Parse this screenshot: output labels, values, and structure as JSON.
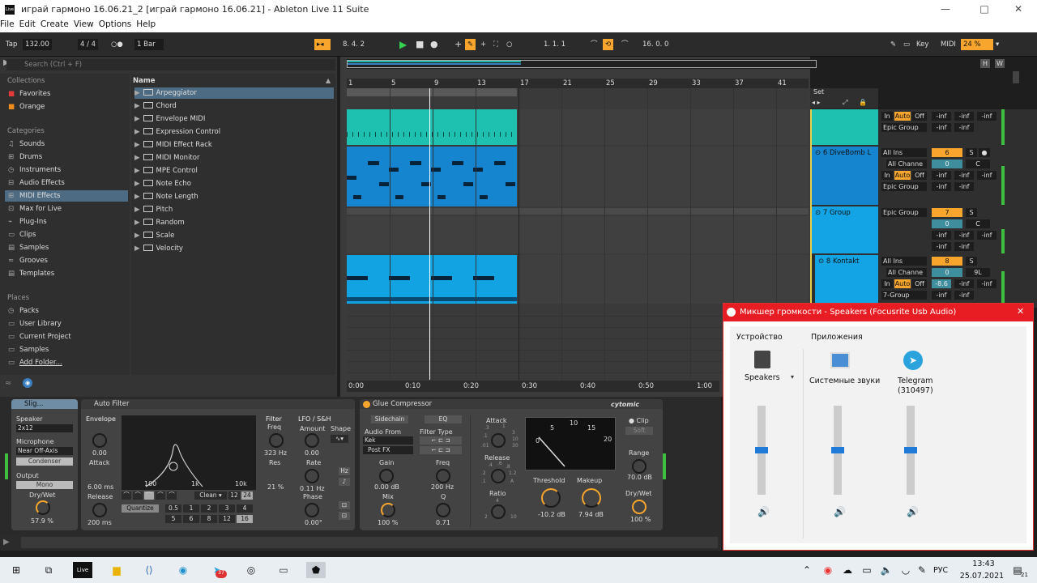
{
  "titlebar": {
    "logo": "Live",
    "title": "играй гармоно 16.06.21_2  [играй гармоно 16.06.21] - Ableton Live 11 Suite",
    "minimize": "—",
    "maximize": "□",
    "close": "✕"
  },
  "menu": [
    "File",
    "Edit",
    "Create",
    "View",
    "Options",
    "Help"
  ],
  "control": {
    "tap": "Tap",
    "tempo": "132.00",
    "signature": "4 / 4",
    "quantize": "1 Bar",
    "position": "8.  4.  2",
    "loop_start": "1.  1.  1",
    "loop_length": "16.  0.  0",
    "key": "Key",
    "midi": "MIDI",
    "cpu": "24 %"
  },
  "browser": {
    "search_placeholder": "Search (Ctrl + F)",
    "collections_header": "Collections",
    "collections": [
      {
        "label": "Favorites",
        "color": "#e33a3a"
      },
      {
        "label": "Orange",
        "color": "#f08c1e"
      }
    ],
    "categories_header": "Categories",
    "categories": [
      "Sounds",
      "Drums",
      "Instruments",
      "Audio Effects",
      "MIDI Effects",
      "Max for Live",
      "Plug-Ins",
      "Clips",
      "Samples",
      "Grooves",
      "Templates"
    ],
    "places_header": "Places",
    "places": [
      "Packs",
      "User Library",
      "Current Project",
      "Samples",
      "Add Folder..."
    ],
    "name_header": "Name",
    "items": [
      "Arpeggiator",
      "Chord",
      "Envelope MIDI",
      "Expression Control",
      "MIDI Effect Rack",
      "MIDI Monitor",
      "MPE Control",
      "Note Echo",
      "Note Length",
      "Pitch",
      "Random",
      "Scale",
      "Velocity"
    ]
  },
  "arrangement": {
    "bars": [
      "1",
      "5",
      "9",
      "13",
      "17",
      "21",
      "25",
      "29",
      "33",
      "37",
      "41"
    ],
    "times": [
      "0:00",
      "0:10",
      "0:20",
      "0:30",
      "0:40",
      "0:50",
      "1:00"
    ],
    "set_label": "Set",
    "hw_h": "H",
    "hw_w": "W"
  },
  "mixer": {
    "rows": [
      {
        "name": "",
        "in": "In",
        "auto": "Auto",
        "off": "Off",
        "group": "Epic Group",
        "vals": [
          "-inf",
          "-inf",
          "-inf",
          "-inf"
        ]
      },
      {
        "name": "6 DiveBomb L",
        "input": "All Ins",
        "channel": "All Channe",
        "num": "6",
        "vol": "0",
        "pan": "C",
        "s": "S",
        "in": "In",
        "auto": "Auto",
        "off": "Off",
        "group": "Epic Group",
        "vals": [
          "-inf",
          "-inf",
          "-inf",
          "-inf",
          "-inf"
        ]
      },
      {
        "name": "7 Group",
        "group": "Epic Group",
        "num": "7",
        "vol": "0",
        "pan": "C",
        "s": "S",
        "vals": [
          "-inf",
          "-inf",
          "-inf",
          "-inf",
          "-inf"
        ]
      },
      {
        "name": "8 Kontakt",
        "input": "All Ins",
        "channel": "All Channe",
        "num": "8",
        "vol": "0",
        "pan": "9L",
        "s": "S",
        "in": "In",
        "auto": "Auto",
        "off": "Off",
        "group": "7-Group",
        "vals": [
          "-8.6",
          "-inf",
          "-inf",
          "-inf",
          "-inf"
        ]
      }
    ]
  },
  "devices": {
    "slig": {
      "title": "Slig...",
      "speaker": "Speaker",
      "speaker_val": "2x12",
      "mic": "Microphone",
      "mic_val": "Near Off-Axis",
      "condenser": "Condenser",
      "output": "Output",
      "mono": "Mono",
      "drywet": "Dry/Wet",
      "drywet_val": "57.9 %"
    },
    "autofilter": {
      "title": "Auto Filter",
      "envelope": "Envelope",
      "env_val": "0.00",
      "attack": "Attack",
      "attack_val": "6.00 ms",
      "release": "Release",
      "release_val": "200 ms",
      "freq_100": "100",
      "freq_1k": "1k",
      "freq_10k": "10k",
      "clean": "Clean",
      "q12": "12",
      "q24": "24",
      "quantize": "Quantize",
      "qvals": [
        "0.5",
        "1",
        "2",
        "3",
        "4",
        "5",
        "6",
        "8",
        "12",
        "16"
      ],
      "filter": "Filter",
      "freq": "Freq",
      "freq_val": "323 Hz",
      "res": "Res",
      "res_val": "21 %",
      "lfo": "LFO / S&H",
      "amount": "Amount",
      "amount_val": "0.00",
      "shape": "Shape",
      "rate": "Rate",
      "rate_val": "0.11 Hz",
      "phase": "Phase",
      "phase_val": "0.00°",
      "hz": "Hz"
    },
    "glue": {
      "title": "Glue Compressor",
      "brand": "cytomic",
      "sidechain": "Sidechain",
      "eq": "EQ",
      "audio_from": "Audio From",
      "source": "Kek",
      "postfx": "Post FX",
      "filter_type": "Filter Type",
      "gain": "Gain",
      "gain_val": "0.00 dB",
      "mix": "Mix",
      "mix_val": "100 %",
      "freq": "Freq",
      "freq_val": "200 Hz",
      "q": "Q",
      "q_val": "0.71",
      "attack": "Attack",
      "attack_ticks": [
        ".3",
        "1",
        "3",
        "10",
        ".1",
        "30",
        ".01"
      ],
      "release": "Release",
      "release_ticks": [
        ".4",
        ".6",
        ".8",
        ".2",
        "1.2",
        ".1",
        "A"
      ],
      "ratio": "Ratio",
      "ratio_ticks": [
        "4",
        "2",
        "10"
      ],
      "meter_ticks": [
        "5",
        "10",
        "15",
        "20",
        "0"
      ],
      "threshold": "Threshold",
      "threshold_val": "-10.2 dB",
      "makeup": "Makeup",
      "makeup_val": "7.94 dB",
      "clip": "Clip",
      "soft": "Soft",
      "range": "Range",
      "range_val": "70.0 dB",
      "drywet": "Dry/Wet",
      "drywet_val": "100 %"
    }
  },
  "popup": {
    "title": "Микшер громкости - Speakers (Focusrite Usb Audio)",
    "close": "✕",
    "device_header": "Устройство",
    "apps_header": "Приложения",
    "channels": [
      {
        "label": "Speakers",
        "level": 0.5
      },
      {
        "label": "Системные звуки",
        "level": 0.5
      },
      {
        "label": "Telegram",
        "sub": "(310497)",
        "level": 0.5
      }
    ]
  },
  "taskbar": {
    "lang": "РУС",
    "time": "13:43",
    "date": "25.07.2021",
    "notif": "21",
    "badge": "37"
  }
}
